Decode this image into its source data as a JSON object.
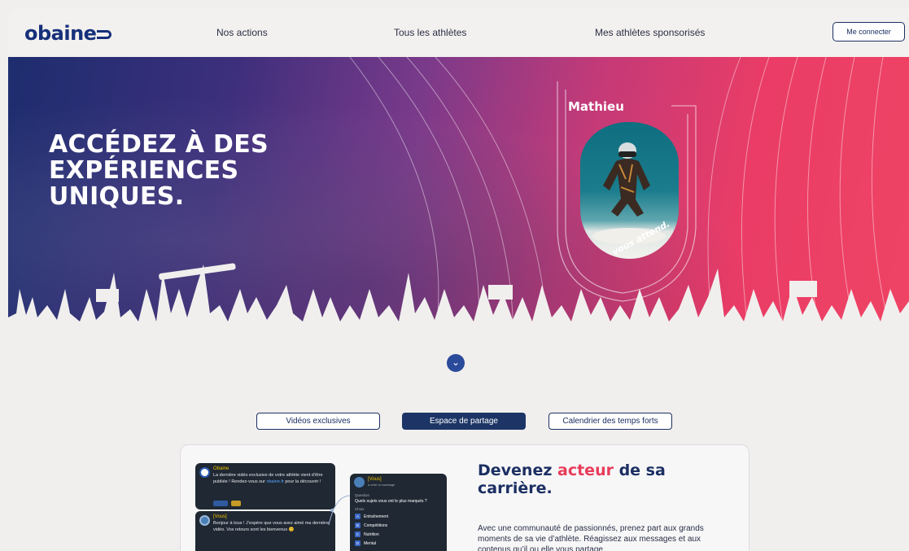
{
  "nav": {
    "logo": "obaine",
    "links": [
      "Nos actions",
      "Tous les athlètes",
      "Mes athlètes sponsorisés"
    ],
    "login_label": "Me connecter"
  },
  "hero": {
    "title": "ACCÉDEZ À DES EXPÉRIENCES UNIQUES.",
    "athlete_name": "Mathieu",
    "athlete_tagline": "vous attend."
  },
  "scroll_icon": "chevron-double-down-icon",
  "tabs": [
    "Vidéos exclusives",
    "Espace de partage",
    "Calendrier des temps forts"
  ],
  "active_tab": "Espace de partage",
  "feature": {
    "title_prefix": "Devenez ",
    "title_accent": "acteur",
    "title_suffix": " de sa carrière.",
    "body": "Avec une communauté de passionnés, prenez part aux grands moments de sa vie d’athlète. Réagissez aux messages et aux contenus qu’il ou elle vous partage."
  },
  "mock_chat": {
    "message1_author": "Obaine",
    "message1_text_a": "La dernière vidéo exclusive de votre athlète vient d’être publiée ! Rendez-vous sur ",
    "message1_link": "obaine.fr",
    "message1_text_b": " pour la découvrir !",
    "message2_author": "[Vous]",
    "message2_text": "Bonjour à tous ! J’espère que vous avez aimé ma dernière vidéo. Vos retours sont les bienvenus 😊",
    "poll_author": "[Vous]",
    "poll_meta": "a créé un sondage",
    "poll_question_label": "Question",
    "poll_question": "Quels sujets vous ont le plus marqués ?",
    "poll_choices_label": "Choix",
    "poll_options": [
      {
        "key": "A",
        "label": "Entraînement"
      },
      {
        "key": "B",
        "label": "Compétitions"
      },
      {
        "key": "C",
        "label": "Nutrition"
      },
      {
        "key": "D",
        "label": "Mental"
      }
    ]
  },
  "colors": {
    "navy": "#1c2f62",
    "accent_red": "#e83d5a",
    "hero_left": "#1d2d6e",
    "hero_right": "#ef4464"
  }
}
